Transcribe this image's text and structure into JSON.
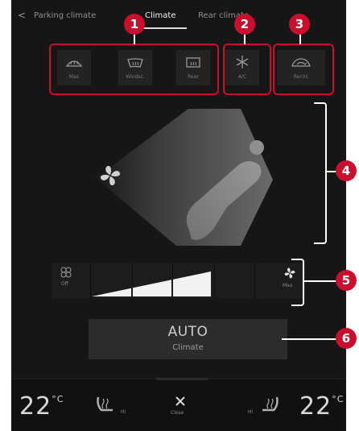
{
  "tabs": {
    "back_symbol": "<",
    "items": [
      {
        "label": "Parking climate"
      },
      {
        "label": "Climate"
      },
      {
        "label": "Rear climate"
      }
    ],
    "active": "Climate"
  },
  "defrost": {
    "max_label": "Max",
    "windscreen_label": "Windsc.",
    "rear_label": "Rear"
  },
  "ac": {
    "label": "A/C"
  },
  "recirc": {
    "label": "Recirc"
  },
  "fan": {
    "off_label": "Off",
    "max_label": "Max",
    "level": 0.4,
    "segments": 5
  },
  "auto": {
    "title": "AUTO",
    "subtitle": "Climate"
  },
  "bottom_bar": {
    "left_temp": "22",
    "right_temp": "22",
    "temp_unit": "°C",
    "left_seat_label": "Hi",
    "right_seat_label": "Hi",
    "center_label": "Close"
  },
  "callouts": [
    "1",
    "2",
    "3",
    "4",
    "5",
    "6"
  ],
  "colors": {
    "callout_red": "#c8102e",
    "background": "#161616",
    "accent_white": "#ffffff"
  }
}
